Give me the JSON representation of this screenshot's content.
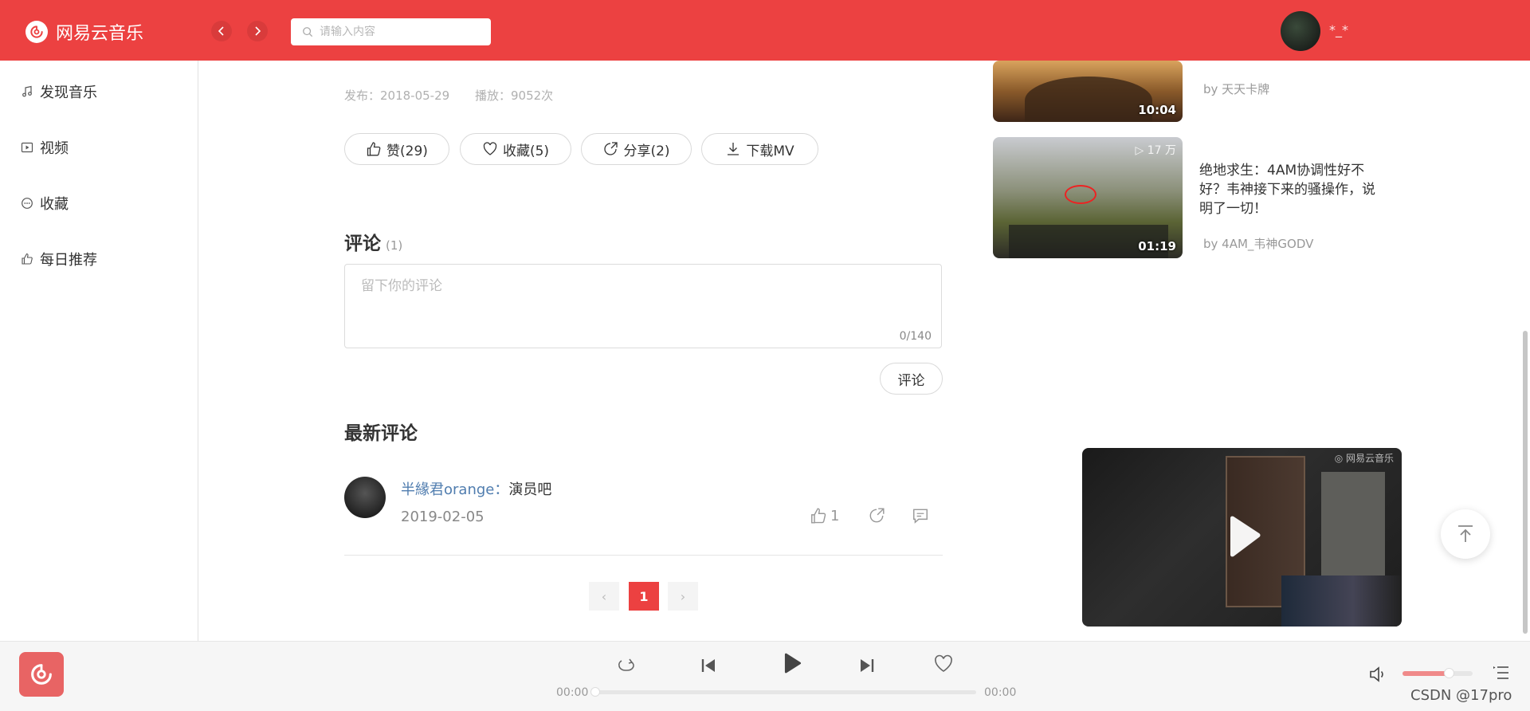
{
  "header": {
    "app_name": "网易云音乐",
    "search_placeholder": "请输入内容",
    "username": "*_*"
  },
  "sidebar": {
    "items": [
      {
        "label": "发现音乐",
        "icon": "music-note-icon"
      },
      {
        "label": "视频",
        "icon": "video-icon"
      },
      {
        "label": "收藏",
        "icon": "collect-icon"
      },
      {
        "label": "每日推荐",
        "icon": "thumbs-up-icon"
      }
    ]
  },
  "video": {
    "publish_label": "发布：2018-05-29",
    "plays_label": "播放：9052次",
    "actions": {
      "like": "赞(29)",
      "collect": "收藏(5)",
      "share": "分享(2)",
      "download": "下载MV"
    }
  },
  "comments": {
    "title": "评论",
    "count": "(1)",
    "placeholder": "留下你的评论",
    "counter": "0/140",
    "submit": "评论",
    "latest_title": "最新评论",
    "items": [
      {
        "user": "半緣君orange",
        "separator": "：",
        "text": "演员吧",
        "date": "2019-02-05",
        "likes": "1"
      }
    ]
  },
  "pagination": {
    "prev": "‹",
    "current": "1",
    "next": "›"
  },
  "related": {
    "items": [
      {
        "duration": "10:04",
        "by": "by 天天卡牌"
      },
      {
        "plays": "▷ 17 万",
        "duration": "01:19",
        "title": "绝地求生：4AM协调性好不好？韦神接下来的骚操作，说明了一切！",
        "by": "by 4AM_韦神GODV"
      }
    ]
  },
  "mini_player": {
    "logo": "◎ 网易云音乐"
  },
  "player": {
    "time_current": "00:00",
    "time_total": "00:00",
    "progress": 0,
    "volume": 0.65
  },
  "watermark": "CSDN @17pro",
  "colors": {
    "brand": "#ec4141",
    "link": "#507daf"
  }
}
